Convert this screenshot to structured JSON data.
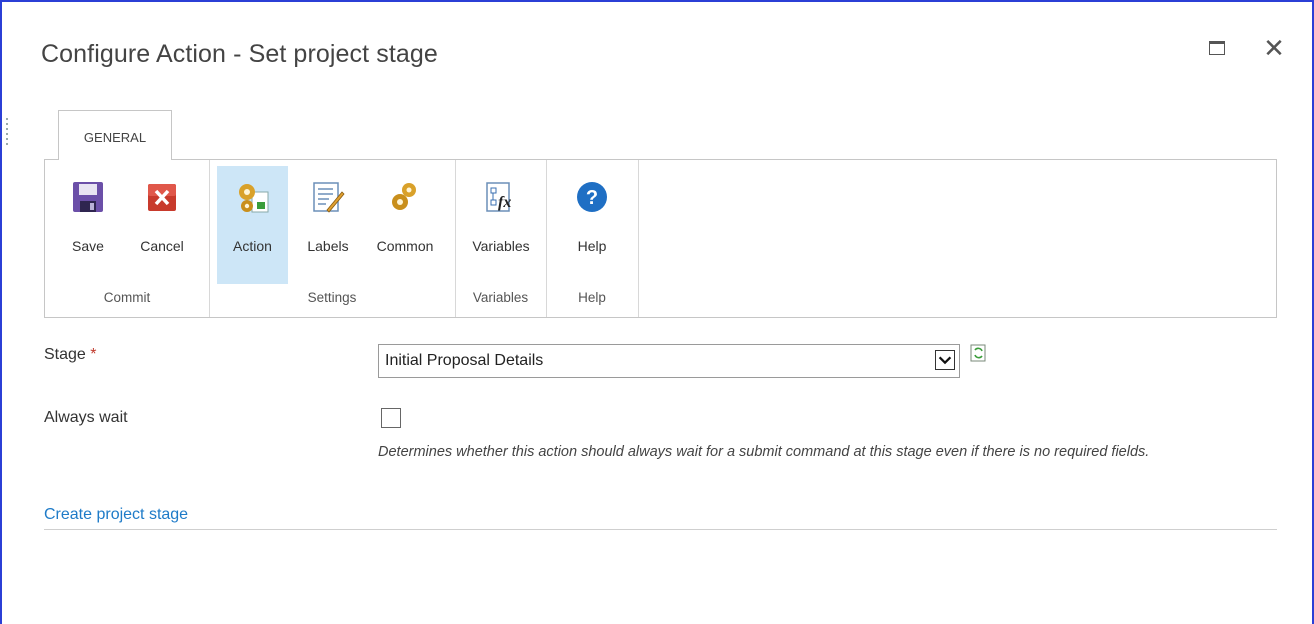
{
  "dialog": {
    "title": "Configure Action - Set project stage"
  },
  "ribbon": {
    "tab": "GENERAL",
    "groups": {
      "commit": {
        "label": "Commit",
        "save": "Save",
        "cancel": "Cancel"
      },
      "settings": {
        "label": "Settings",
        "action": "Action",
        "labels": "Labels",
        "common": "Common"
      },
      "variables": {
        "label": "Variables",
        "variables": "Variables"
      },
      "help": {
        "label": "Help",
        "help": "Help"
      }
    },
    "selected": "Action"
  },
  "form": {
    "stage_label": "Stage",
    "required_marker": "*",
    "stage_value": "Initial Proposal Details",
    "always_wait_label": "Always wait",
    "always_wait_checked": false,
    "always_wait_desc": "Determines whether this action should always wait for a submit command at this stage even if there is no required fields.",
    "create_link": "Create project stage"
  },
  "colors": {
    "accent": "#1e7bc8",
    "selected_bg": "#cde6f7",
    "required": "#c0392b",
    "window_border": "#2b3fd6"
  }
}
